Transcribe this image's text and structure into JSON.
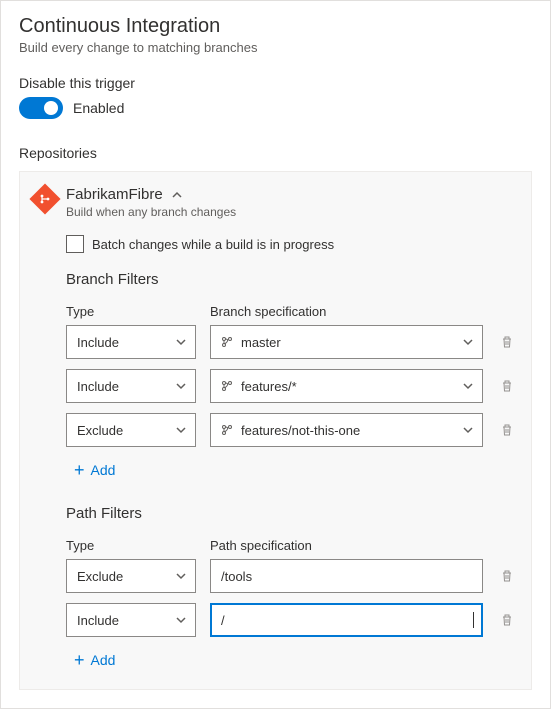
{
  "page": {
    "title": "Continuous Integration",
    "subtitle": "Build every change to matching branches"
  },
  "disable": {
    "label": "Disable this trigger",
    "state_label": "Enabled"
  },
  "repos": {
    "section_label": "Repositories",
    "name": "FabrikamFibre",
    "sub": "Build when any branch changes",
    "batch_label": "Batch changes while a build is in progress"
  },
  "branch_filters": {
    "title": "Branch Filters",
    "type_header": "Type",
    "spec_header": "Branch specification",
    "rows": [
      {
        "type": "Include",
        "spec": "master"
      },
      {
        "type": "Include",
        "spec": "features/*"
      },
      {
        "type": "Exclude",
        "spec": "features/not-this-one"
      }
    ],
    "add_label": "Add"
  },
  "path_filters": {
    "title": "Path Filters",
    "type_header": "Type",
    "spec_header": "Path specification",
    "rows": [
      {
        "type": "Exclude",
        "spec": "/tools"
      },
      {
        "type": "Include",
        "spec": "/"
      }
    ],
    "add_label": "Add"
  }
}
